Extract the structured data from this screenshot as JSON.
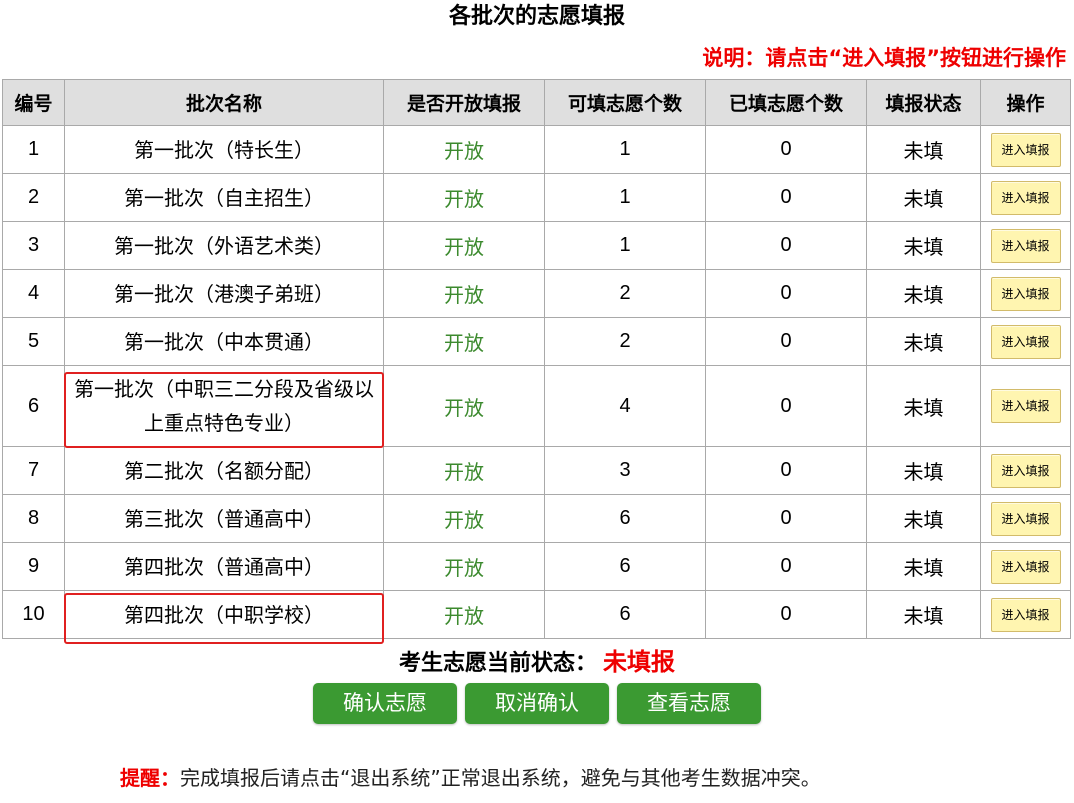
{
  "page": {
    "title": "各批次的志愿填报",
    "instruction": "说明：请点击“进入填报”按钮进行操作"
  },
  "table": {
    "headers": [
      "编号",
      "批次名称",
      "是否开放填报",
      "可填志愿个数",
      "已填志愿个数",
      "填报状态",
      "操作"
    ],
    "rows": [
      {
        "num": "1",
        "name": "第一批次（特长生）",
        "open": "开放",
        "capacity": "1",
        "filled": "0",
        "status": "未填",
        "action": "进入填报"
      },
      {
        "num": "2",
        "name": "第一批次（自主招生）",
        "open": "开放",
        "capacity": "1",
        "filled": "0",
        "status": "未填",
        "action": "进入填报"
      },
      {
        "num": "3",
        "name": "第一批次（外语艺术类）",
        "open": "开放",
        "capacity": "1",
        "filled": "0",
        "status": "未填",
        "action": "进入填报"
      },
      {
        "num": "4",
        "name": "第一批次（港澳子弟班）",
        "open": "开放",
        "capacity": "2",
        "filled": "0",
        "status": "未填",
        "action": "进入填报"
      },
      {
        "num": "5",
        "name": "第一批次（中本贯通）",
        "open": "开放",
        "capacity": "2",
        "filled": "0",
        "status": "未填",
        "action": "进入填报"
      },
      {
        "num": "6",
        "name": "第一批次（中职三二分段及省级以上重点特色专业）",
        "open": "开放",
        "capacity": "4",
        "filled": "0",
        "status": "未填",
        "action": "进入填报"
      },
      {
        "num": "7",
        "name": "第二批次（名额分配）",
        "open": "开放",
        "capacity": "3",
        "filled": "0",
        "status": "未填",
        "action": "进入填报"
      },
      {
        "num": "8",
        "name": "第三批次（普通高中）",
        "open": "开放",
        "capacity": "6",
        "filled": "0",
        "status": "未填",
        "action": "进入填报"
      },
      {
        "num": "9",
        "name": "第四批次（普通高中）",
        "open": "开放",
        "capacity": "6",
        "filled": "0",
        "status": "未填",
        "action": "进入填报"
      },
      {
        "num": "10",
        "name": "第四批次（中职学校）",
        "open": "开放",
        "capacity": "6",
        "filled": "0",
        "status": "未填",
        "action": "进入填报"
      }
    ]
  },
  "status": {
    "label": "考生志愿当前状态：",
    "value": "未填报"
  },
  "buttons": {
    "confirm": "确认志愿",
    "cancel": "取消确认",
    "view": "查看志愿"
  },
  "reminder": {
    "label": "提醒：",
    "text": "完成填报后请点击“退出系统”正常退出系统，避免与其他考生数据冲突。"
  },
  "colors": {
    "warning_red": "#ee0000",
    "open_green": "#3c8a2e",
    "button_green": "#3b9a32",
    "action_button_yellow": "#fff5b0",
    "header_gray": "#dfdfdf"
  }
}
